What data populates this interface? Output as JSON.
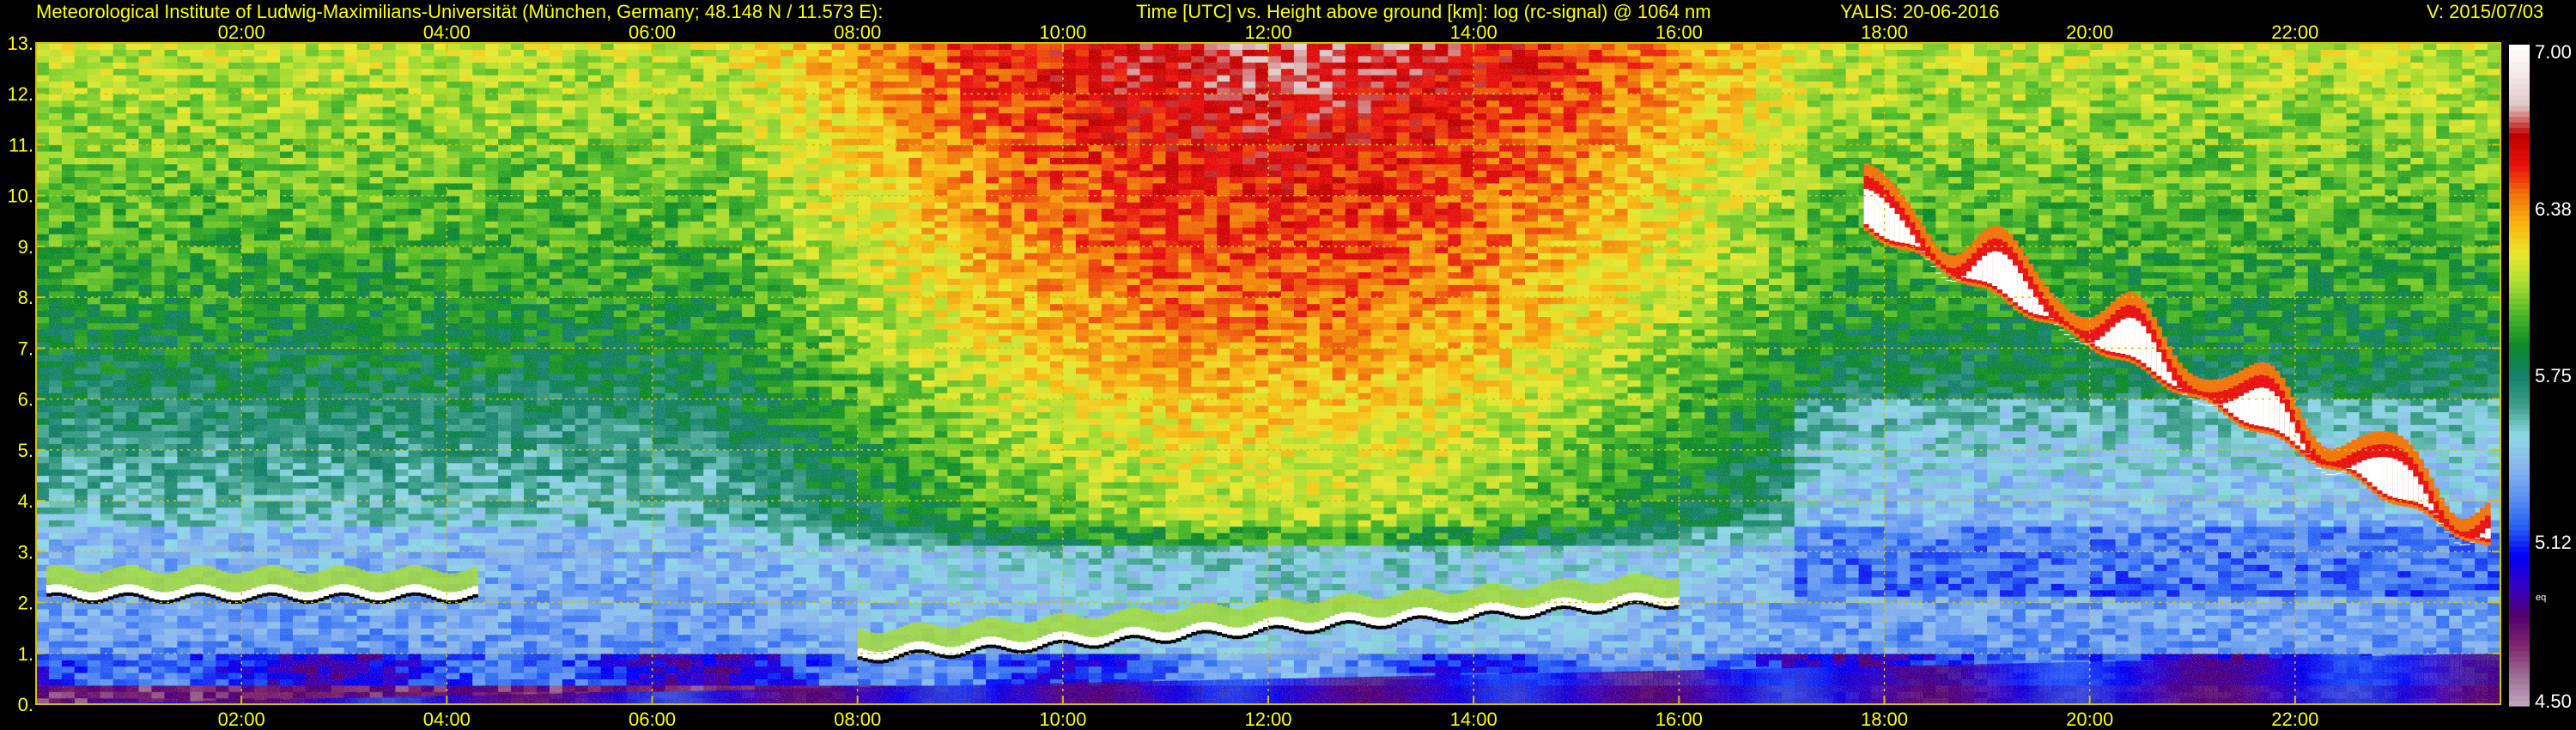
{
  "header": {
    "institute": "Meteorological Institute of Ludwig-Maximilians-Universität (München, Germany; 48.148 N / 11.573 E):",
    "plot_title": "Time [UTC] vs. Height above ground [km]: log (rc-signal) @ 1064 nm",
    "instrument_date": "YALIS: 20-06-2016",
    "version": "V: 2015/07/03"
  },
  "colors": {
    "background": "#000000",
    "text": "#ffff00",
    "grid": "#d4c200"
  },
  "chart_data": {
    "type": "heatmap",
    "title": "Time [UTC] vs. Height above ground [km]: log (rc-signal) @ 1064 nm",
    "xlabel": "Time [UTC]",
    "ylabel": "Height above ground [km]",
    "x_unit": "hours UTC",
    "xlim": [
      0,
      24
    ],
    "ylim": [
      0,
      13
    ],
    "x_ticks": [
      2,
      4,
      6,
      8,
      10,
      12,
      14,
      16,
      18,
      20,
      22
    ],
    "x_tick_labels": [
      "02:00",
      "04:00",
      "06:00",
      "08:00",
      "10:00",
      "12:00",
      "14:00",
      "16:00",
      "18:00",
      "20:00",
      "22:00"
    ],
    "y_ticks": [
      0,
      1,
      2,
      3,
      4,
      5,
      6,
      7,
      8,
      9,
      10,
      11,
      12,
      13
    ],
    "y_tick_labels": [
      "0.",
      "1.",
      "2.",
      "3.",
      "4.",
      "5.",
      "6.",
      "7.",
      "8.",
      "9.",
      "10.",
      "11.",
      "12.",
      "13."
    ],
    "grid": true,
    "colorbar": {
      "min": 4.5,
      "max": 7.0,
      "ticks": [
        4.5,
        5.12,
        5.75,
        6.38,
        7.0
      ],
      "tick_labels": [
        "4.50",
        "5.12",
        "5.75",
        "6.38",
        "7.00"
      ],
      "small_label": "eq",
      "colormap": [
        "#c2a6c0",
        "#9e6e96",
        "#80266e",
        "#54006e",
        "#3600c6",
        "#0000f4",
        "#2a62f4",
        "#5e94f2",
        "#8ab6ee",
        "#8ed8e6",
        "#3ea08a",
        "#14806a",
        "#0e8a28",
        "#48b628",
        "#a4dc30",
        "#e8e830",
        "#f8b812",
        "#f0740a",
        "#e81010",
        "#c00000",
        "#e0c8c8",
        "#f4e8e8",
        "#ffffff"
      ]
    },
    "features": [
      {
        "name": "boundary layer top (strong return)",
        "time_start": 0.1,
        "time_end": 4.3,
        "height_km": 2.2,
        "value": 7.0
      },
      {
        "name": "boundary layer top",
        "time_start": 8.0,
        "time_end": 16.0,
        "height_km_start": 1.0,
        "height_km_end": 2.1,
        "value": 7.0
      },
      {
        "name": "cirrus layer",
        "time_start": 17.8,
        "time_end": 23.9,
        "height_km_start": 9.3,
        "height_km_end": 3.0,
        "value": 7.0
      },
      {
        "name": "near-surface aerosol",
        "time_start": 0.0,
        "time_end": 24.0,
        "height_km_start": 0.0,
        "height_km_end": 1.0,
        "value": 5.0
      }
    ]
  }
}
